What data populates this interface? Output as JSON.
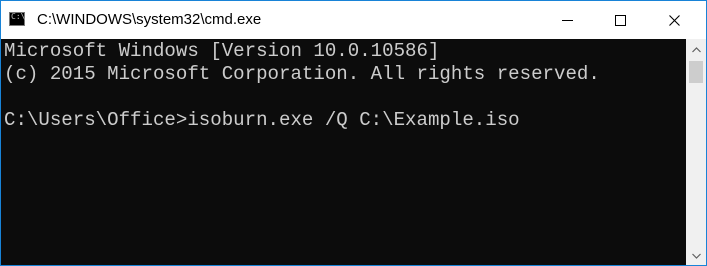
{
  "window": {
    "title": "C:\\WINDOWS\\system32\\cmd.exe",
    "icon": "cmd-icon",
    "border_color": "#1883d7"
  },
  "titlebar": {
    "icon_prompt": "C:\\",
    "buttons": {
      "minimize_icon": "minimize-icon",
      "maximize_icon": "maximize-icon",
      "close_icon": "close-icon"
    }
  },
  "console": {
    "background": "#0c0c0c",
    "foreground": "#cccccc",
    "lines": [
      "Microsoft Windows [Version 10.0.10586]",
      "(c) 2015 Microsoft Corporation. All rights reserved.",
      "",
      "C:\\Users\\Office>isoburn.exe /Q C:\\Example.iso"
    ]
  },
  "scrollbar": {
    "up_icon": "scroll-up-arrow-icon",
    "down_icon": "scroll-down-arrow-icon"
  }
}
